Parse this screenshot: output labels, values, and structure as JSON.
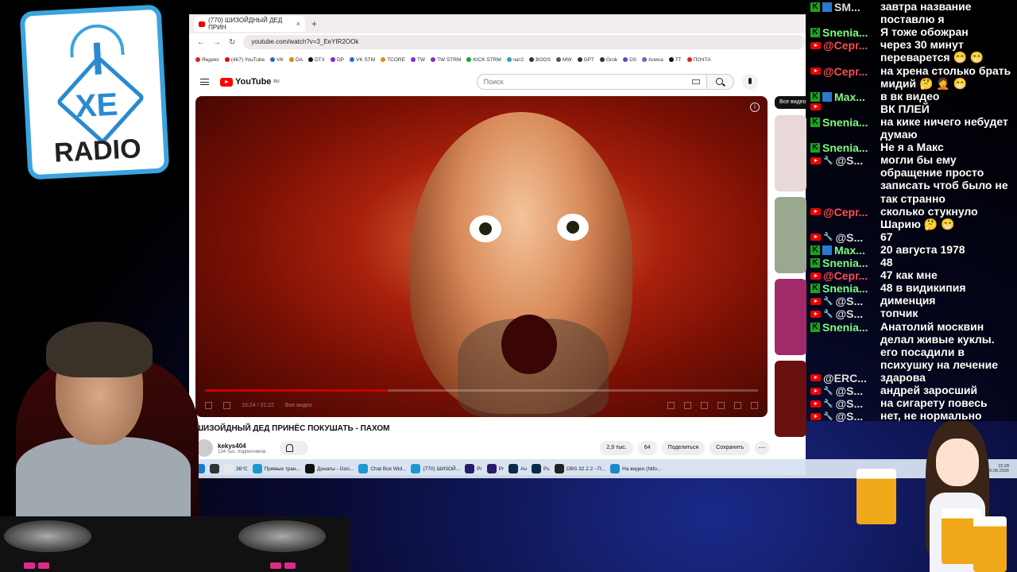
{
  "logo": {
    "xe": "XE",
    "radio": "RADIO"
  },
  "browser": {
    "tab_title": "(770) ШИЗОЙДНЫЙ ДЕД ПРИН",
    "tab_close": "×",
    "new_tab": "+",
    "nav": {
      "back": "←",
      "forward": "→",
      "reload": "↻"
    },
    "url": "youtube.com/watch?v=3_EeYIR2OOk",
    "bookmarks": [
      "Яндекс",
      "(467) YouTube",
      "VK",
      "DA",
      "DTX",
      "DP",
      "VK STM",
      "TCORE",
      "TW",
      "TW STRM",
      "KICK STRM",
      "чат2",
      "BOOS",
      "MW",
      "GPT",
      "Grok",
      "DS",
      "Алиса",
      "TT",
      "ПОЧТА"
    ],
    "bookmark_colors": [
      "#d22",
      "#e00",
      "#2a6ad0",
      "#e08a00",
      "#111",
      "#7a2ad0",
      "#2a6ad0",
      "#e08a00",
      "#8a2ad0",
      "#8a2ad0",
      "#1aa41a",
      "#2a9ad0",
      "#333",
      "#555",
      "#333",
      "#333",
      "#5a4ad0",
      "#7a5ad0",
      "#111",
      "#d22"
    ]
  },
  "youtube": {
    "logo_text": "YouTube",
    "logo_sup": "RU",
    "search_placeholder": "Поиск",
    "video": {
      "info": "i",
      "time": "10:24 / 31:22",
      "chapter": "Вне видео",
      "progress_fraction": 0.33
    },
    "title": "ШИЗОЙДНЫЙ ДЕД ПРИНЁС ПОКУШАТЬ - ПАХОМ",
    "channel": "kekys404",
    "subscribers": "134 тыс. подписчиков",
    "likes": "2,9 тыс.",
    "dislikes": "64",
    "share": "Поделиться",
    "save": "Сохранить",
    "more": "⋯",
    "side_chip": "Все видео"
  },
  "taskbar": {
    "items": [
      "36°C",
      "Прямые тран...",
      "Донаты - Goo...",
      "Chat Box Wid...",
      "(770) ШИЗОЙ...",
      "Pr",
      "Pr",
      "Au",
      "Ps",
      "OBS 32.2.2 - П...",
      "На видео (Nifo..."
    ],
    "clock_time": "22:28",
    "clock_date": "20.08.2026"
  },
  "chat": {
    "rows": [
      {
        "platform": "kick",
        "badge": true,
        "nick": "SM...",
        "nick_color": "grey",
        "message": "завтра название"
      },
      {
        "platform": "",
        "nick": "",
        "message": "поставлю я"
      },
      {
        "platform": "kick",
        "nick": "Snenia...",
        "nick_color": "green",
        "message": "Я тоже обожран"
      },
      {
        "platform": "yt",
        "nick": "@Серг...",
        "nick_color": "red",
        "message": "через 30 минут"
      },
      {
        "platform": "",
        "nick": "",
        "message": "переварется 😁 😁"
      },
      {
        "platform": "yt",
        "nick": "@Серг...",
        "nick_color": "red",
        "message": "на хрена столько брать"
      },
      {
        "platform": "",
        "nick": "",
        "message": "мидий 🤔 🤦 😁"
      },
      {
        "platform": "kick",
        "badge": true,
        "nick": "Max...",
        "nick_color": "green",
        "message": "в вк видео"
      },
      {
        "platform": "yt",
        "nick": "",
        "message": "ВК ПЛЕЙ"
      },
      {
        "platform": "kick",
        "nick": "Snenia...",
        "nick_color": "green",
        "message": "на кике ничего небудет"
      },
      {
        "platform": "",
        "nick": "",
        "message": "думаю"
      },
      {
        "platform": "kick",
        "nick": "Snenia...",
        "nick_color": "green",
        "message": "Не я а Макс"
      },
      {
        "platform": "yt",
        "wrench": true,
        "nick": "@S...",
        "nick_color": "grey",
        "message": "могли бы ему"
      },
      {
        "platform": "",
        "nick": "",
        "message": "обращение просто"
      },
      {
        "platform": "",
        "nick": "",
        "message": "записать чтоб было не"
      },
      {
        "platform": "",
        "nick": "",
        "message": "так странно"
      },
      {
        "platform": "yt",
        "nick": "@Серг...",
        "nick_color": "red",
        "message": "сколько стукнуло"
      },
      {
        "platform": "",
        "nick": "",
        "message": "Шарию 🤔 😁"
      },
      {
        "platform": "yt",
        "wrench": true,
        "nick": "@S...",
        "nick_color": "grey",
        "message": "67"
      },
      {
        "platform": "kick",
        "badge": true,
        "nick": "Max...",
        "nick_color": "green",
        "message": "20 августа 1978"
      },
      {
        "platform": "kick",
        "nick": "Snenia...",
        "nick_color": "green",
        "message": "48"
      },
      {
        "platform": "yt",
        "nick": "@Серг...",
        "nick_color": "red",
        "message": "47 как мне"
      },
      {
        "platform": "kick",
        "nick": "Snenia...",
        "nick_color": "green",
        "message": "48 в видикипия"
      },
      {
        "platform": "yt",
        "wrench": true,
        "nick": "@S...",
        "nick_color": "grey",
        "message": "дименция"
      },
      {
        "platform": "yt",
        "wrench": true,
        "nick": "@S...",
        "nick_color": "grey",
        "message": "топчик"
      },
      {
        "platform": "kick",
        "nick": "Snenia...",
        "nick_color": "green",
        "message": "Анатолий москвин"
      },
      {
        "platform": "",
        "nick": "",
        "message": "делал живые куклы."
      },
      {
        "platform": "",
        "nick": "",
        "message": "его посадили в"
      },
      {
        "platform": "",
        "nick": "",
        "message": "психушку на лечение"
      },
      {
        "platform": "yt",
        "nick": "@ERC...",
        "nick_color": "grey",
        "message": "здарова"
      },
      {
        "platform": "yt",
        "wrench": true,
        "nick": "@S...",
        "nick_color": "grey",
        "message": "андрей заросший"
      },
      {
        "platform": "yt",
        "wrench": true,
        "nick": "@S...",
        "nick_color": "grey",
        "message": "на сигарету повесь"
      },
      {
        "platform": "yt",
        "wrench": true,
        "nick": "@S...",
        "nick_color": "grey",
        "message": "нет, не нормально"
      }
    ]
  }
}
